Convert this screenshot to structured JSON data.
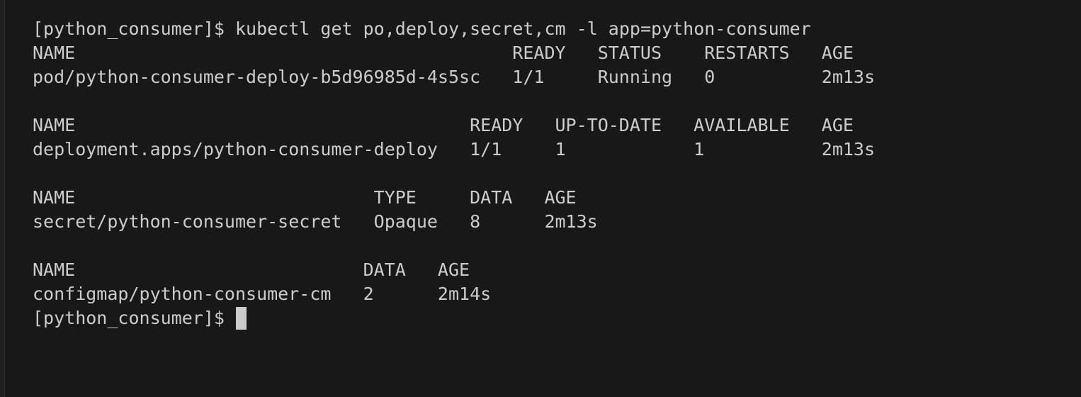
{
  "prompt": "[python_consumer]$",
  "command": "kubectl get po,deploy,secret,cm -l app=python-consumer",
  "pods": {
    "headers": [
      "NAME",
      "READY",
      "STATUS",
      "RESTARTS",
      "AGE"
    ],
    "rows": [
      [
        "pod/python-consumer-deploy-b5d96985d-4s5sc",
        "1/1",
        "Running",
        "0",
        "2m13s"
      ]
    ]
  },
  "deployments": {
    "headers": [
      "NAME",
      "READY",
      "UP-TO-DATE",
      "AVAILABLE",
      "AGE"
    ],
    "rows": [
      [
        "deployment.apps/python-consumer-deploy",
        "1/1",
        "1",
        "1",
        "2m13s"
      ]
    ]
  },
  "secrets": {
    "headers": [
      "NAME",
      "TYPE",
      "DATA",
      "AGE"
    ],
    "rows": [
      [
        "secret/python-consumer-secret",
        "Opaque",
        "8",
        "2m13s"
      ]
    ]
  },
  "configmaps": {
    "headers": [
      "NAME",
      "DATA",
      "AGE"
    ],
    "rows": [
      [
        "configmap/python-consumer-cm",
        "2",
        "2m14s"
      ]
    ]
  },
  "colors": {
    "background": "#181818",
    "text": "#cccccc"
  }
}
